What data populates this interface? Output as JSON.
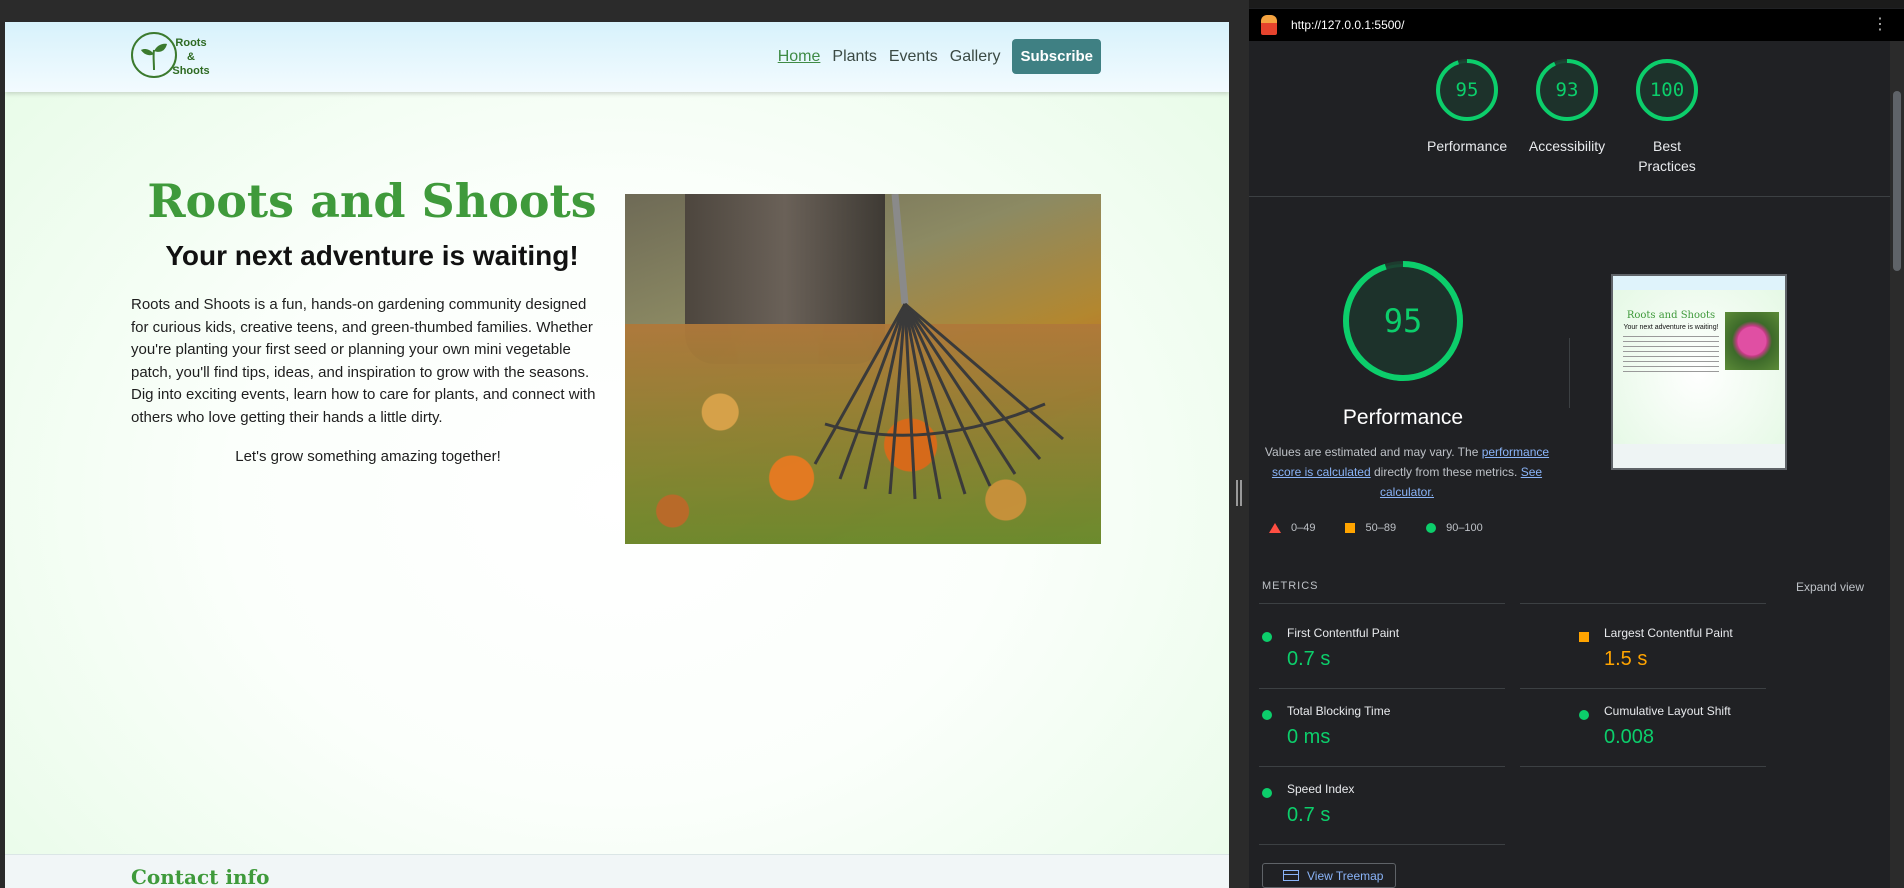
{
  "site": {
    "logo": {
      "line1": "Roots",
      "line2": "&",
      "line3": "Shoots"
    },
    "nav": [
      {
        "label": "Home"
      },
      {
        "label": "Plants"
      },
      {
        "label": "Events"
      },
      {
        "label": "Gallery"
      }
    ],
    "subscribe_label": "Subscribe",
    "hero": {
      "title": "Roots and Shoots",
      "subtitle": "Your next adventure is waiting!",
      "body": "Roots and Shoots is a fun, hands-on gardening community designed for curious kids, creative teens, and green-thumbed families. Whether you're planting your first seed or planning your own mini vegetable patch, you'll find tips, ideas, and inspiration to grow with the seasons. Dig into exciting events, learn how to care for plants, and connect with others who love getting their hands a little dirty.",
      "cta": "Let's grow something amazing together!"
    },
    "footer": {
      "contact_title": "Contact info"
    }
  },
  "lighthouse": {
    "url": "http://127.0.0.1:5500/",
    "scores": [
      {
        "value": "95",
        "label": "Performance",
        "fraction": 0.95
      },
      {
        "value": "93",
        "label": "Accessibility",
        "fraction": 0.93
      },
      {
        "value": "100",
        "label": "Best Practices",
        "fraction": 1.0
      }
    ],
    "main_score": {
      "value": "95",
      "label": "Performance",
      "fraction": 0.95
    },
    "desc_prefix": "Values are estimated and may vary. The ",
    "desc_link1": "performance score is calculated",
    "desc_mid": " directly from these metrics. ",
    "desc_link2": "See calculator.",
    "legend": [
      {
        "label": "0–49"
      },
      {
        "label": "50–89"
      },
      {
        "label": "90–100"
      }
    ],
    "metrics_header": "METRICS",
    "expand_view": "Expand view",
    "metrics": [
      {
        "name": "First Contentful Paint",
        "value": "0.7 s",
        "status": "pass"
      },
      {
        "name": "Largest Contentful Paint",
        "value": "1.5 s",
        "status": "average"
      },
      {
        "name": "Total Blocking Time",
        "value": "0 ms",
        "status": "pass"
      },
      {
        "name": "Cumulative Layout Shift",
        "value": "0.008",
        "status": "pass"
      },
      {
        "name": "Speed Index",
        "value": "0.7 s",
        "status": "pass"
      }
    ],
    "treemap_label": "View Treemap",
    "colors": {
      "pass": "#0cce6b",
      "average": "#ffa400",
      "fail": "#ff4e42"
    }
  }
}
